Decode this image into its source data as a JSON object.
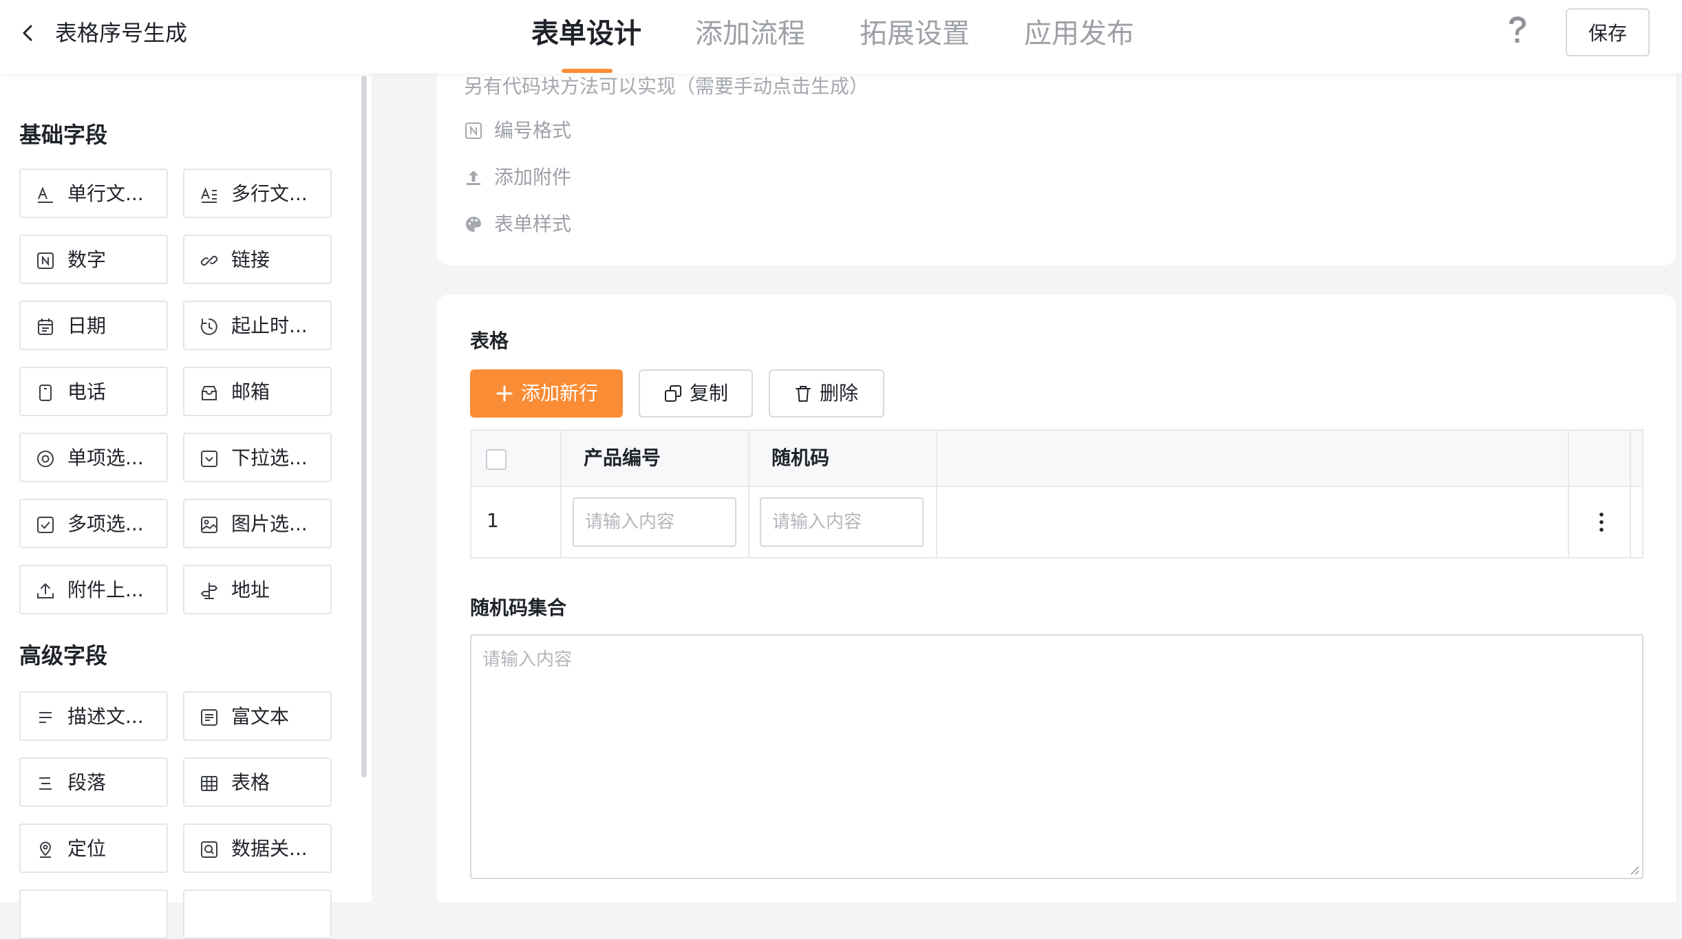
{
  "header": {
    "title": "表格序号生成",
    "tabs": [
      {
        "label": "表单设计",
        "active": true
      },
      {
        "label": "添加流程",
        "active": false
      },
      {
        "label": "拓展设置",
        "active": false
      },
      {
        "label": "应用发布",
        "active": false
      }
    ],
    "save_label": "保存",
    "accent_color": "#fa8c35"
  },
  "sidebar": {
    "basic_title": "基础字段",
    "basic_fields": [
      {
        "label": "单行文...",
        "icon": "single-line-text-icon"
      },
      {
        "label": "多行文...",
        "icon": "multi-line-text-icon"
      },
      {
        "label": "数字",
        "icon": "number-icon"
      },
      {
        "label": "链接",
        "icon": "link-icon"
      },
      {
        "label": "日期",
        "icon": "calendar-icon"
      },
      {
        "label": "起止时...",
        "icon": "time-range-icon"
      },
      {
        "label": "电话",
        "icon": "phone-icon"
      },
      {
        "label": "邮箱",
        "icon": "mailbox-icon"
      },
      {
        "label": "单项选...",
        "icon": "radio-icon"
      },
      {
        "label": "下拉选...",
        "icon": "dropdown-icon"
      },
      {
        "label": "多项选...",
        "icon": "checkbox-icon"
      },
      {
        "label": "图片选...",
        "icon": "image-icon"
      },
      {
        "label": "附件上...",
        "icon": "upload-icon"
      },
      {
        "label": "地址",
        "icon": "signpost-icon"
      }
    ],
    "advanced_title": "高级字段",
    "advanced_fields": [
      {
        "label": "描述文...",
        "icon": "description-text-icon"
      },
      {
        "label": "富文本",
        "icon": "rich-text-icon"
      },
      {
        "label": "段落",
        "icon": "paragraph-icon"
      },
      {
        "label": "表格",
        "icon": "table-icon"
      },
      {
        "label": "定位",
        "icon": "location-icon"
      },
      {
        "label": "数据关...",
        "icon": "data-link-icon"
      }
    ]
  },
  "settings_card": {
    "hint": "另有代码块方法可以实现（需要手动点击生成）",
    "options": [
      {
        "label": "编号格式",
        "icon": "number-format-icon"
      },
      {
        "label": "添加附件",
        "icon": "upload-attachment-icon"
      },
      {
        "label": "表单样式",
        "icon": "palette-icon"
      }
    ]
  },
  "table_card": {
    "title": "表格",
    "add_row_label": "添加新行",
    "copy_label": "复制",
    "delete_label": "删除",
    "columns": [
      "产品编号",
      "随机码"
    ],
    "rows": [
      {
        "index": "1",
        "values": [
          "",
          ""
        ]
      }
    ],
    "cell_placeholder": "请输入内容",
    "textarea_label": "随机码集合",
    "textarea_placeholder": "请输入内容"
  }
}
